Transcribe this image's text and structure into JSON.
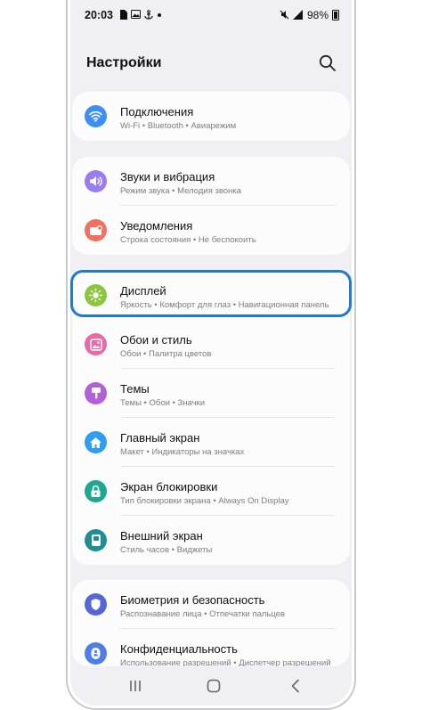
{
  "status_bar": {
    "time": "20:03",
    "battery": "98%",
    "left_icons": [
      "sim-card-icon",
      "gallery-icon",
      "anchor-icon",
      "dot-icon"
    ],
    "right_icons": [
      "mute-icon",
      "signal-icon",
      "battery-icon"
    ]
  },
  "header": {
    "title": "Настройки",
    "search_icon": "search-icon"
  },
  "groups": [
    {
      "items": [
        {
          "title": "Подключения",
          "subtitle": "Wi-Fi  •  Bluetooth  •  Авиарежим",
          "icon": "wifi-icon",
          "color": "#3d8ff3"
        }
      ]
    },
    {
      "items": [
        {
          "title": "Звуки и вибрация",
          "subtitle": "Режим звука  •  Мелодия звонка",
          "icon": "speaker-icon",
          "color": "#9a7cf2"
        },
        {
          "title": "Уведомления",
          "subtitle": "Строка состояния  •  Не беспокоить",
          "icon": "notification-icon",
          "color": "#f2705f"
        }
      ]
    },
    {
      "items": [
        {
          "title": "Дисплей",
          "subtitle": "Яркость  •  Комфорт для глаз  •  Навигационная панель",
          "icon": "brightness-icon",
          "color": "#8cc63f",
          "highlighted": true
        },
        {
          "title": "Обои и стиль",
          "subtitle": "Обои  •  Палитра цветов",
          "icon": "wallpaper-icon",
          "color": "#ea6aa8"
        },
        {
          "title": "Темы",
          "subtitle": "Темы  •  Обои  •  Значки",
          "icon": "themes-icon",
          "color": "#b160da"
        },
        {
          "title": "Главный экран",
          "subtitle": "Макет  •  Индикаторы на значках",
          "icon": "home-icon",
          "color": "#2e9ef3"
        },
        {
          "title": "Экран блокировки",
          "subtitle": "Тип блокировки экрана  •  Always On Display",
          "icon": "lock-icon",
          "color": "#1fa890"
        },
        {
          "title": "Внешний экран",
          "subtitle": "Стиль часов  •  Виджеты",
          "icon": "cover-screen-icon",
          "color": "#1b8f93"
        }
      ]
    },
    {
      "items": [
        {
          "title": "Биометрия и безопасность",
          "subtitle": "Распознавание лица  •  Отпечатки пальцев",
          "icon": "shield-icon",
          "color": "#5566d9"
        },
        {
          "title": "Конфиденциальность",
          "subtitle": "Использование разрешений  •  Диспетчер разрешений",
          "icon": "privacy-icon",
          "color": "#4f7ee8"
        }
      ]
    }
  ],
  "nav_bar": {
    "recents_icon": "recents-icon",
    "home_icon": "home-button-icon",
    "back_icon": "back-icon"
  }
}
